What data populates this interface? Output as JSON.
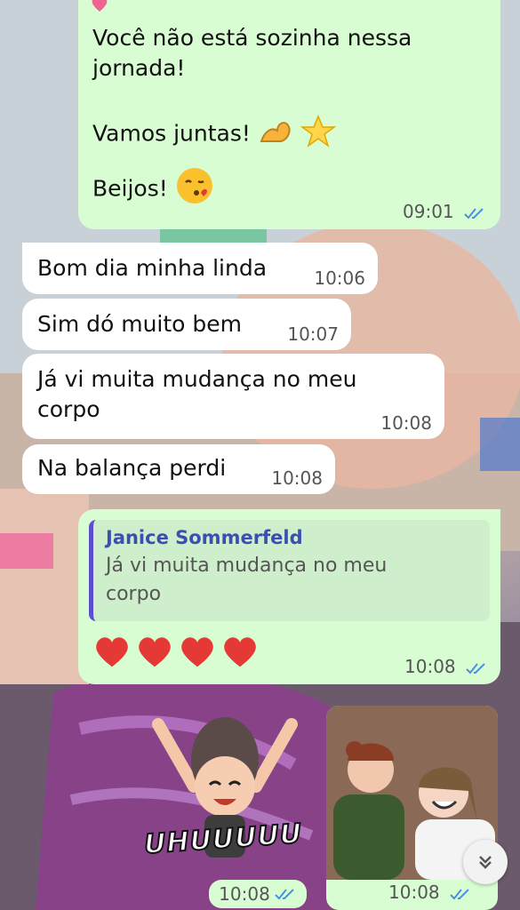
{
  "messages": [
    {
      "id": "m1",
      "type": "outgoing",
      "lines": [
        "Você não está sozinha nessa",
        "jornada!",
        "",
        "Vamos juntas!",
        "Beijos!"
      ],
      "time": "09:01"
    },
    {
      "id": "m2",
      "type": "incoming",
      "text": "Bom dia minha linda",
      "time": "10:06"
    },
    {
      "id": "m3",
      "type": "incoming",
      "text": "Sim dó muito bem",
      "time": "10:07"
    },
    {
      "id": "m4",
      "type": "incoming",
      "lines": [
        "Já vi muita mudança no meu",
        "corpo"
      ],
      "time": "10:08"
    },
    {
      "id": "m5",
      "type": "incoming",
      "text": "Na balança perdi",
      "time": "10:08"
    },
    {
      "id": "m6",
      "type": "outgoing",
      "reply_author": "Janice Sommerfeld",
      "reply_lines": [
        "Já vi muita mudança no meu",
        "corpo"
      ],
      "hearts_count": 4,
      "time": "10:08"
    }
  ],
  "sticker": {
    "caption": "UHUUUUU",
    "time": "10:08"
  },
  "gif_message": {
    "time": "10:08"
  },
  "icons": {
    "read_receipt": "double-check-icon",
    "scroll": "chevron-down-double-icon"
  },
  "colors": {
    "outgoing": "#d9fdd3",
    "incoming": "#ffffff",
    "read_tick": "#4a90e2"
  }
}
